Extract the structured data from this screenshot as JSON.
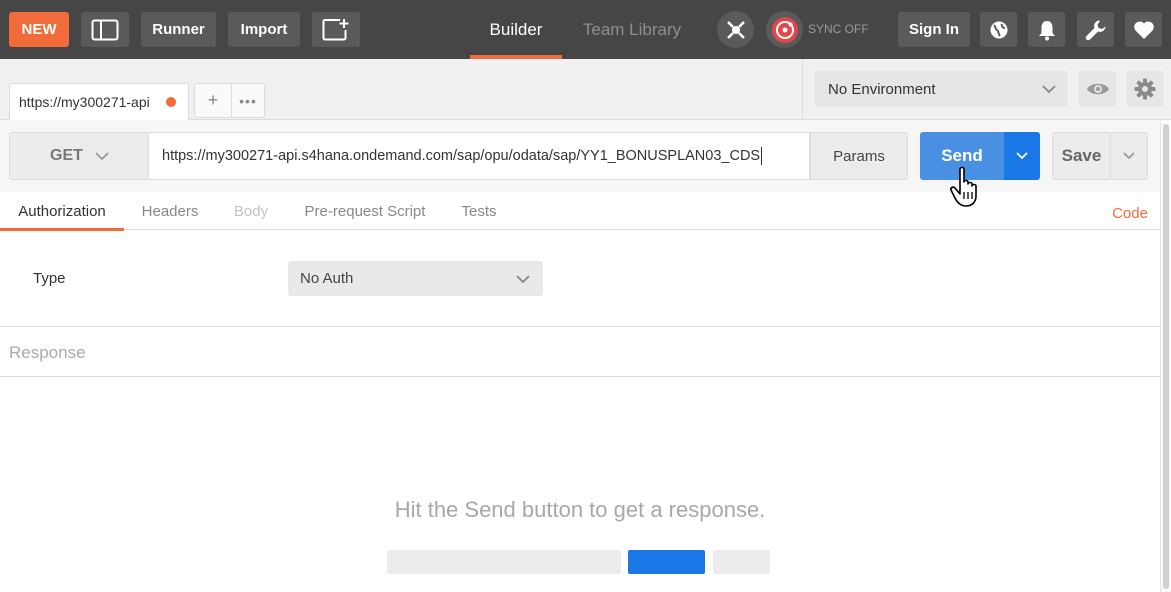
{
  "toolbar": {
    "new_label": "NEW",
    "runner_label": "Runner",
    "import_label": "Import",
    "builder_label": "Builder",
    "team_library_label": "Team Library",
    "sync_label": "SYNC OFF",
    "signin_label": "Sign In"
  },
  "tabs": {
    "request_tab_label": "https://my300271-api",
    "add_label": "+",
    "more_label": "•••"
  },
  "environment": {
    "selected": "No Environment"
  },
  "request": {
    "method": "GET",
    "url": "https://my300271-api.s4hana.ondemand.com/sap/opu/odata/sap/YY1_BONUSPLAN03_CDS",
    "params_label": "Params",
    "send_label": "Send",
    "save_label": "Save"
  },
  "subtabs": {
    "authorization": "Authorization",
    "headers": "Headers",
    "body": "Body",
    "pre_request": "Pre-request Script",
    "tests": "Tests",
    "code": "Code"
  },
  "auth": {
    "type_label": "Type",
    "type_value": "No Auth"
  },
  "response": {
    "label": "Response",
    "hint": "Hit the Send button to get a response."
  },
  "colors": {
    "accent": "#f26b3a",
    "send_blue": "#4a90e2",
    "toolbar_bg": "#464646"
  }
}
